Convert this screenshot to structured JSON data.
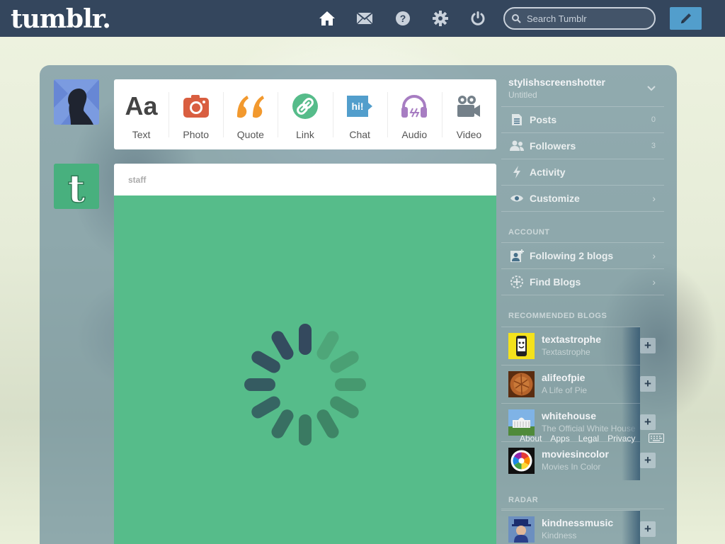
{
  "header": {
    "logo": "tumblr.",
    "search_placeholder": "Search Tumblr"
  },
  "post_types": [
    {
      "label": "Text",
      "icon": "text-icon",
      "color": "#444444"
    },
    {
      "label": "Photo",
      "icon": "camera-icon",
      "color": "#d95e40"
    },
    {
      "label": "Quote",
      "icon": "quote-icon",
      "color": "#f2992e"
    },
    {
      "label": "Link",
      "icon": "link-icon",
      "color": "#56bc8a"
    },
    {
      "label": "Chat",
      "icon": "chat-icon",
      "color": "#529ecc"
    },
    {
      "label": "Audio",
      "icon": "headphones-icon",
      "color": "#a77dc2"
    },
    {
      "label": "Video",
      "icon": "video-camera-icon",
      "color": "#748089"
    }
  ],
  "post": {
    "author": "staff"
  },
  "sidebar": {
    "blog_name": "stylishscreenshotter",
    "blog_title": "Untitled",
    "rows": [
      {
        "label": "Posts",
        "count": "0"
      },
      {
        "label": "Followers",
        "count": "3"
      },
      {
        "label": "Activity"
      },
      {
        "label": "Customize"
      }
    ],
    "account_heading": "ACCOUNT",
    "account_rows": [
      {
        "label": "Following 2 blogs"
      },
      {
        "label": "Find Blogs"
      }
    ],
    "recommended_heading": "RECOMMENDED BLOGS",
    "recommended": [
      {
        "name": "textastrophe",
        "title": "Textastrophe"
      },
      {
        "name": "alifeofpie",
        "title": "A Life of Pie"
      },
      {
        "name": "whitehouse",
        "title": "The Official White House"
      },
      {
        "name": "moviesincolor",
        "title": "Movies In Color"
      }
    ],
    "radar_heading": "RADAR",
    "radar": [
      {
        "name": "kindnessmusic",
        "title": "Kindness"
      }
    ]
  },
  "footer": {
    "links": [
      "About",
      "Apps",
      "Legal",
      "Privacy"
    ]
  },
  "colors": {
    "header_bg": "#34465d",
    "accent": "#529ecc",
    "post_green": "#56bc8a"
  }
}
